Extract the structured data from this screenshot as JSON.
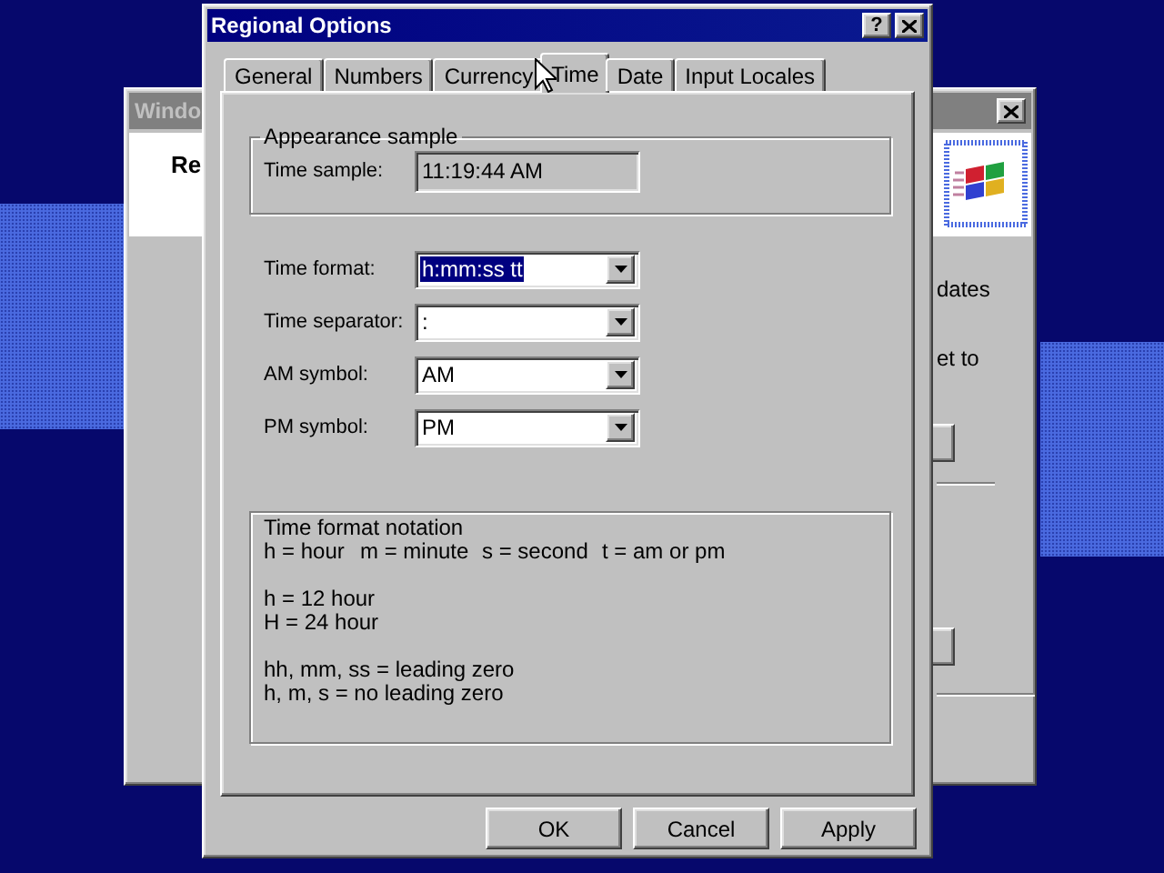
{
  "background_window": {
    "title": "Windo",
    "heading": "Re",
    "texts": [
      "dates",
      "et to"
    ]
  },
  "dialog": {
    "title": "Regional Options",
    "help": "?",
    "tabs": [
      {
        "label": "General",
        "selected": false
      },
      {
        "label": "Numbers",
        "selected": false
      },
      {
        "label": "Currency",
        "selected": false
      },
      {
        "label": "Time",
        "selected": true
      },
      {
        "label": "Date",
        "selected": false
      },
      {
        "label": "Input Locales",
        "selected": false
      }
    ],
    "appearance_sample": {
      "legend": "Appearance sample",
      "label": "Time sample:",
      "value": "11:19:44 AM"
    },
    "fields": [
      {
        "label": "Time format:",
        "value": "h:mm:ss tt",
        "highlighted": true
      },
      {
        "label": "Time separator:",
        "value": ":",
        "highlighted": false
      },
      {
        "label": "AM symbol:",
        "value": "AM",
        "highlighted": false
      },
      {
        "label": "PM symbol:",
        "value": "PM",
        "highlighted": false
      }
    ],
    "notation": {
      "legend": "Time format notation",
      "keys": [
        "h = hour",
        "m = minute",
        "s = second",
        "t = am or pm"
      ],
      "blocks": [
        [
          "h = 12 hour",
          "H = 24 hour"
        ],
        [
          "hh, mm, ss = leading zero",
          "h, m, s = no leading zero"
        ]
      ]
    },
    "buttons": [
      "OK",
      "Cancel",
      "Apply"
    ]
  }
}
